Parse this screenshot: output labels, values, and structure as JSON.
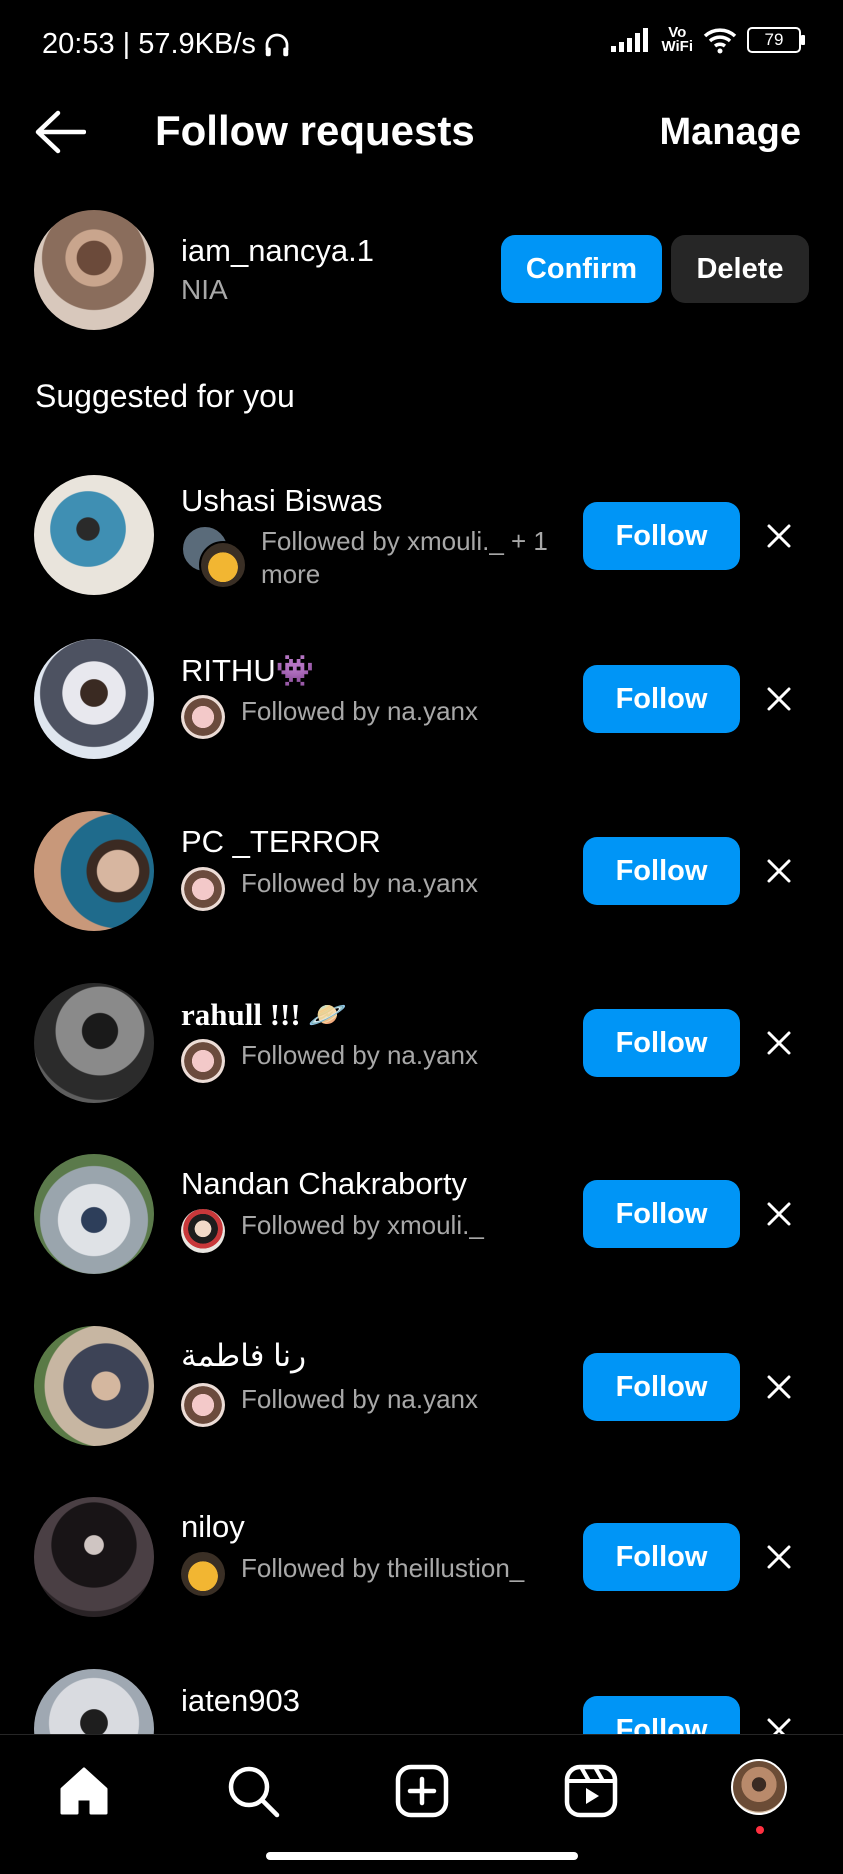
{
  "status_bar": {
    "time_speed": "20:53 | 57.9KB/s",
    "vowifi_top": "Vo",
    "vowifi_bottom": "WiFi",
    "battery": "79"
  },
  "header": {
    "title": "Follow requests",
    "manage_label": "Manage"
  },
  "request": {
    "username": "iam_nancya.1",
    "name": "NIA",
    "confirm_label": "Confirm",
    "delete_label": "Delete"
  },
  "suggested_title": "Suggested for you",
  "suggested": [
    {
      "name": "Ushasi Biswas",
      "followed_by": "Followed by xmouli._ + 1 more",
      "follow_label": "Follow"
    },
    {
      "name": "RITHU👾",
      "followed_by": "Followed by na.yanx",
      "follow_label": "Follow"
    },
    {
      "name": "PC _TERROR",
      "followed_by": "Followed by na.yanx",
      "follow_label": "Follow"
    },
    {
      "name": "rahull !!! 🪐",
      "followed_by": "Followed by na.yanx",
      "follow_label": "Follow"
    },
    {
      "name": "Nandan Chakraborty",
      "followed_by": "Followed by xmouli._",
      "follow_label": "Follow"
    },
    {
      "name": "رنا فاطمة",
      "followed_by": "Followed by na.yanx",
      "follow_label": "Follow"
    },
    {
      "name": "niloy",
      "followed_by": "Followed by theillustion_",
      "follow_label": "Follow"
    },
    {
      "name": "iaten903",
      "followed_by": "",
      "follow_label": "Follow"
    }
  ],
  "nav": [
    "home-icon",
    "search-icon",
    "create-icon",
    "reels-icon",
    "profile-avatar"
  ],
  "colors": {
    "accent": "#0095f6",
    "secondary_button": "#262626",
    "muted_text": "#a8a8a8",
    "notification_dot": "#ff3040"
  }
}
